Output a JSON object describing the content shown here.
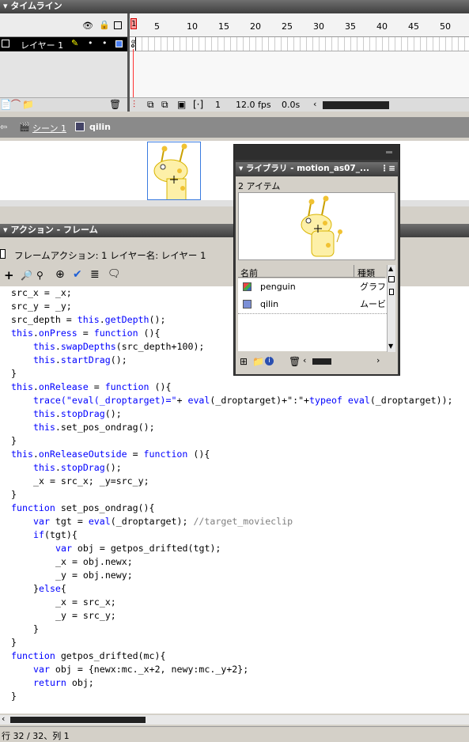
{
  "timeline": {
    "title": "タイムライン",
    "frame_numbers": [
      "5",
      "10",
      "15",
      "20",
      "25",
      "30",
      "35",
      "40",
      "45",
      "50"
    ],
    "current_frame_marker": "1",
    "layer_name": "レイヤー 1",
    "status": {
      "frame": "1",
      "fps": "12.0 fps",
      "time": "0.0s"
    },
    "eye_icon": "eye-icon",
    "lock_icon": "lock-icon",
    "outline_icon": "outline-icon"
  },
  "breadcrumb": {
    "scene": "シーン 1",
    "symbol": "qilin"
  },
  "library": {
    "title": "ライブラリ - motion_as07_...",
    "item_count": "2 アイテム",
    "col_name": "名前",
    "col_kind": "種類",
    "items": [
      {
        "name": "penguin",
        "kind": "グラフィ"
      },
      {
        "name": "qilin",
        "kind": "ムービ"
      }
    ]
  },
  "actions": {
    "title": "アクション - フレーム",
    "subtitle": "フレームアクション: 1 レイヤー名: レイヤー 1",
    "code_lines": [
      {
        "indent": 0,
        "segs": [
          {
            "t": "src_x = _x;"
          }
        ]
      },
      {
        "indent": 0,
        "segs": [
          {
            "t": "src_y = _y;"
          }
        ]
      },
      {
        "indent": 0,
        "segs": [
          {
            "t": "src_depth = "
          },
          {
            "t": "this",
            "k": 1
          },
          {
            "t": "."
          },
          {
            "t": "getDepth",
            "k": 1
          },
          {
            "t": "();"
          }
        ]
      },
      {
        "indent": 0,
        "segs": [
          {
            "t": "this",
            "k": 1
          },
          {
            "t": "."
          },
          {
            "t": "onPress",
            "k": 1
          },
          {
            "t": " = "
          },
          {
            "t": "function",
            "k": 1
          },
          {
            "t": " (){"
          }
        ]
      },
      {
        "indent": 1,
        "segs": [
          {
            "t": "this",
            "k": 1
          },
          {
            "t": "."
          },
          {
            "t": "swapDepths",
            "k": 1
          },
          {
            "t": "(src_depth+100);"
          }
        ]
      },
      {
        "indent": 1,
        "segs": [
          {
            "t": "this",
            "k": 1
          },
          {
            "t": "."
          },
          {
            "t": "startDrag",
            "k": 1
          },
          {
            "t": "();"
          }
        ]
      },
      {
        "indent": 0,
        "segs": [
          {
            "t": "}"
          }
        ]
      },
      {
        "indent": 0,
        "segs": [
          {
            "t": "this",
            "k": 1
          },
          {
            "t": "."
          },
          {
            "t": "onRelease",
            "k": 1
          },
          {
            "t": " = "
          },
          {
            "t": "function",
            "k": 1
          },
          {
            "t": " (){"
          }
        ]
      },
      {
        "indent": 1,
        "segs": [
          {
            "t": "trace",
            "k": 1
          },
          {
            "t": "(\"eval(_droptarget)=\"",
            "k": 1
          },
          {
            "t": "+ "
          },
          {
            "t": "eval",
            "k": 1
          },
          {
            "t": "(_droptarget)+\":\"+"
          },
          {
            "t": "typeof",
            "k": 1
          },
          {
            "t": " "
          },
          {
            "t": "eval",
            "k": 1
          },
          {
            "t": "(_droptarget));"
          }
        ]
      },
      {
        "indent": 1,
        "segs": [
          {
            "t": "this",
            "k": 1
          },
          {
            "t": "."
          },
          {
            "t": "stopDrag",
            "k": 1
          },
          {
            "t": "();"
          }
        ]
      },
      {
        "indent": 1,
        "segs": [
          {
            "t": "this",
            "k": 1
          },
          {
            "t": ".set_pos_ondrag();"
          }
        ]
      },
      {
        "indent": 0,
        "segs": [
          {
            "t": "}"
          }
        ]
      },
      {
        "indent": 0,
        "segs": [
          {
            "t": "this",
            "k": 1
          },
          {
            "t": "."
          },
          {
            "t": "onReleaseOutside",
            "k": 1
          },
          {
            "t": " = "
          },
          {
            "t": "function",
            "k": 1
          },
          {
            "t": " (){"
          }
        ]
      },
      {
        "indent": 1,
        "segs": [
          {
            "t": "this",
            "k": 1
          },
          {
            "t": "."
          },
          {
            "t": "stopDrag",
            "k": 1
          },
          {
            "t": "();"
          }
        ]
      },
      {
        "indent": 1,
        "segs": [
          {
            "t": "_x = src_x; _y=src_y;"
          }
        ]
      },
      {
        "indent": 0,
        "segs": [
          {
            "t": "}"
          }
        ]
      },
      {
        "indent": 0,
        "segs": [
          {
            "t": "function",
            "k": 1
          },
          {
            "t": " set_pos_ondrag(){"
          }
        ]
      },
      {
        "indent": 1,
        "segs": [
          {
            "t": "var",
            "k": 1
          },
          {
            "t": " tgt = "
          },
          {
            "t": "eval",
            "k": 1
          },
          {
            "t": "(_droptarget); "
          },
          {
            "t": "//target_movieclip",
            "c": 1
          }
        ]
      },
      {
        "indent": 1,
        "segs": [
          {
            "t": "if",
            "k": 1
          },
          {
            "t": "(tgt){"
          }
        ]
      },
      {
        "indent": 2,
        "segs": [
          {
            "t": "var",
            "k": 1
          },
          {
            "t": " obj = getpos_drifted(tgt);"
          }
        ]
      },
      {
        "indent": 2,
        "segs": [
          {
            "t": "_x = obj.newx;"
          }
        ]
      },
      {
        "indent": 2,
        "segs": [
          {
            "t": "_y = obj.newy;"
          }
        ]
      },
      {
        "indent": 1,
        "segs": [
          {
            "t": "}"
          },
          {
            "t": "else",
            "k": 1
          },
          {
            "t": "{"
          }
        ]
      },
      {
        "indent": 2,
        "segs": [
          {
            "t": "_x = src_x;"
          }
        ]
      },
      {
        "indent": 2,
        "segs": [
          {
            "t": "_y = src_y;"
          }
        ]
      },
      {
        "indent": 1,
        "segs": [
          {
            "t": "}"
          }
        ]
      },
      {
        "indent": 0,
        "segs": [
          {
            "t": "}"
          }
        ]
      },
      {
        "indent": 0,
        "segs": [
          {
            "t": "function",
            "k": 1
          },
          {
            "t": " getpos_drifted(mc){"
          }
        ]
      },
      {
        "indent": 1,
        "segs": [
          {
            "t": "var",
            "k": 1
          },
          {
            "t": " obj = {newx:mc._x+2, newy:mc._y+2};"
          }
        ]
      },
      {
        "indent": 1,
        "segs": [
          {
            "t": "return",
            "k": 1
          },
          {
            "t": " obj;"
          }
        ]
      },
      {
        "indent": 0,
        "segs": [
          {
            "t": "}"
          }
        ]
      }
    ],
    "status_line": "行 32 / 32、列 1"
  }
}
